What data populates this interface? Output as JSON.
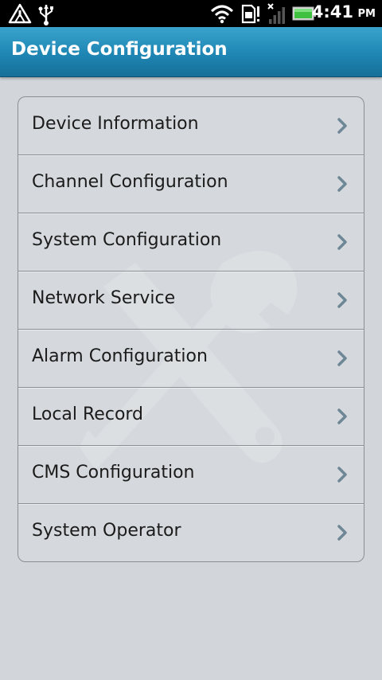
{
  "status_bar": {
    "time": "4:41",
    "ampm": "PM",
    "icons": [
      "warning-icon",
      "usb-icon",
      "wifi-icon",
      "sd-card-alert-icon",
      "no-signal-icon",
      "battery-icon"
    ],
    "battery_color": "#3fc03f"
  },
  "header": {
    "title": "Device Configuration",
    "color": "#1f86b4"
  },
  "menu": {
    "items": [
      {
        "label": "Device Information"
      },
      {
        "label": "Channel Configuration"
      },
      {
        "label": "System Configuration"
      },
      {
        "label": "Network Service"
      },
      {
        "label": "Alarm Configuration"
      },
      {
        "label": "Local Record"
      },
      {
        "label": "CMS Configuration"
      },
      {
        "label": "System Operator"
      }
    ],
    "chevron_icon": "chevron-right-icon",
    "chevron_color": "#6e8796"
  },
  "watermark_icon": "wrench-screwdriver-icon"
}
